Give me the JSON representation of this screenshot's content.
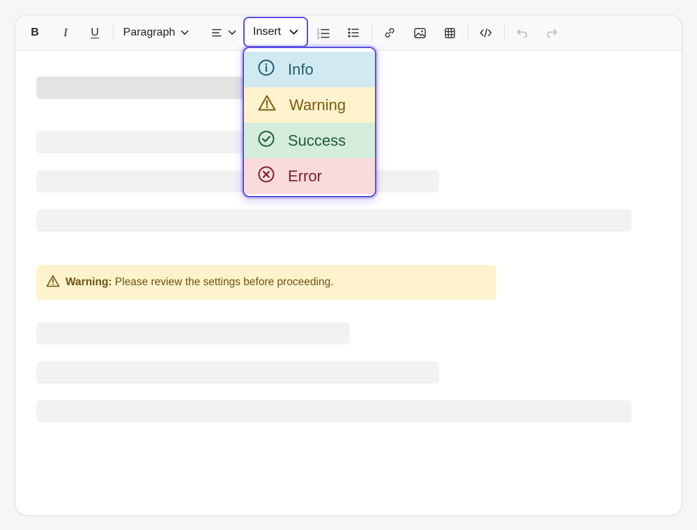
{
  "toolbar": {
    "bold_label": "B",
    "italic_label": "I",
    "underline_label": "U",
    "block_format": "Paragraph",
    "insert_label": "Insert",
    "icons": {
      "align": "align-left-icon",
      "ordered_list": "ordered-list-icon",
      "bullet_list": "bullet-list-icon",
      "link": "link-icon",
      "image": "image-icon",
      "table": "table-icon",
      "code": "code-icon",
      "undo": "undo-icon",
      "redo": "redo-icon"
    }
  },
  "insert_menu": {
    "items": [
      {
        "label": "Info",
        "icon": "info-icon",
        "bg": "#d1e9f0",
        "fg": "#1f5d6b"
      },
      {
        "label": "Warning",
        "icon": "warning-icon",
        "bg": "#fff3cd",
        "fg": "#7a5c0f"
      },
      {
        "label": "Success",
        "icon": "check-circle-icon",
        "bg": "#d4ecdb",
        "fg": "#1f5c32"
      },
      {
        "label": "Error",
        "icon": "x-circle-icon",
        "bg": "#f8d9dc",
        "fg": "#7a1f2a"
      }
    ]
  },
  "content": {
    "callout": {
      "type": "warning",
      "title": "Warning:",
      "text": "Please review the settings before proceeding."
    }
  },
  "colors": {
    "accent": "#5b4de3",
    "placeholder_bar": "#f2f2f3",
    "callout_warning_bg": "#fff3cd"
  }
}
